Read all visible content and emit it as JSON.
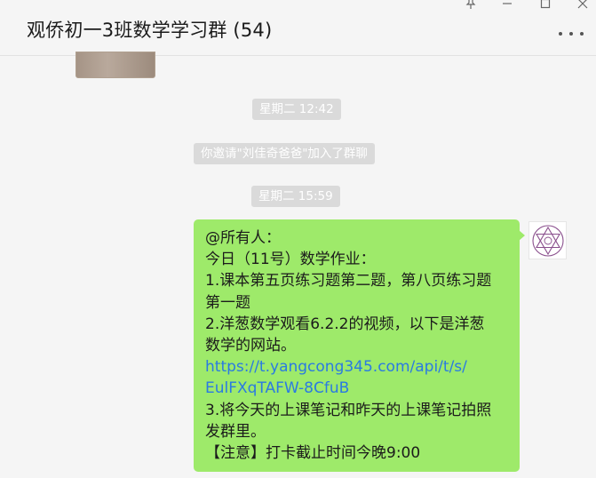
{
  "window": {
    "title": "观侨初一3班数学学习群 (54)",
    "controls": [
      "pin-icon",
      "minimize-icon",
      "maximize-icon",
      "close-icon"
    ],
    "more_icon": "more-dots-icon"
  },
  "timeline": {
    "time1": "星期二 12:42",
    "system_notice": "你邀请\"刘佳奇爸爸\"加入了群聊",
    "time2": "星期二 15:59"
  },
  "message": {
    "lines": [
      "@所有人：",
      "今日（11号）数学作业：",
      "1.课本第五页练习题第二题，第八页练习题",
      "第一题",
      "2.洋葱数学观看6.2.2的视频，以下是洋葱",
      "数学的网站。"
    ],
    "link_lines": [
      "https://t.yangcong345.com/api/t/s/",
      "EulFXqTAFW-8CfuB"
    ],
    "tail_lines": [
      "3.将今天的上课笔记和昨天的上课笔记拍照",
      "发群里。",
      "【注意】打卡截止时间今晚9:00"
    ]
  },
  "colors": {
    "background": "#f5f5f5",
    "bubble": "#9eea6a",
    "link": "#2a7ae2",
    "system_bg": "#dadada",
    "avatar_star": "#8a4f8d"
  },
  "avatar": {
    "icon": "star-of-david-icon"
  }
}
